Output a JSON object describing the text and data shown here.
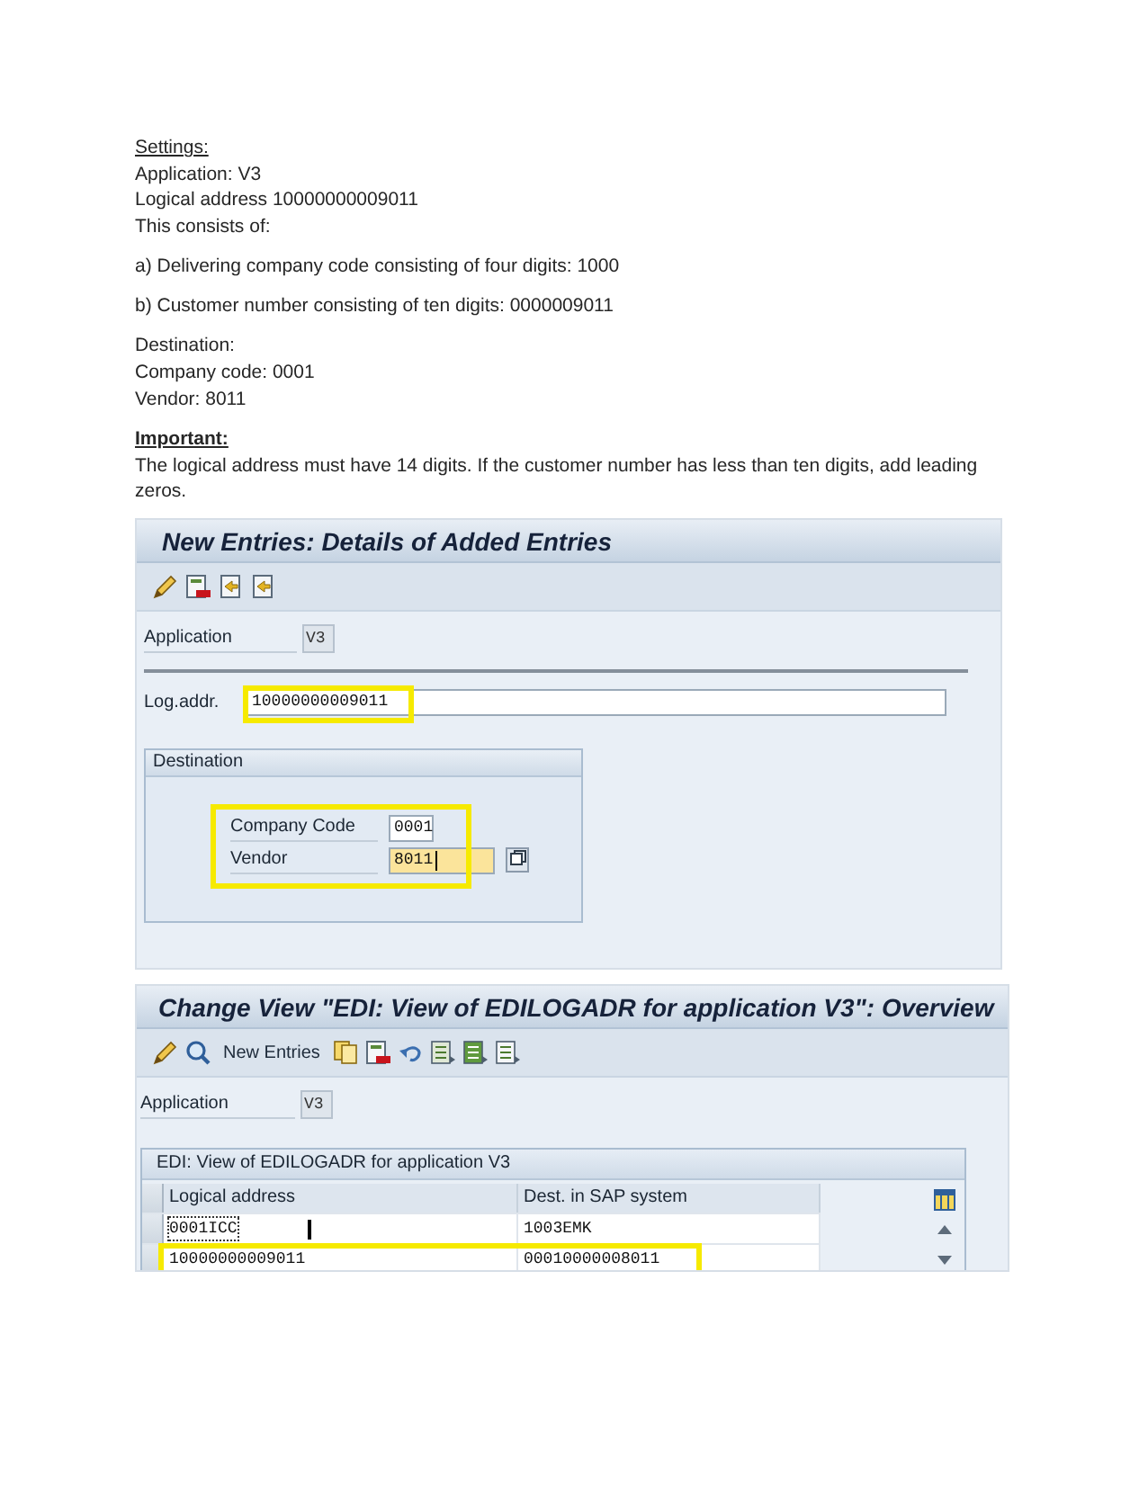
{
  "notes": {
    "settings_heading": "Settings:",
    "settings_lines": [
      "Application: V3",
      "Logical address 10000000009011",
      "This consists of:"
    ],
    "parts": [
      "a) Delivering company code consisting of four digits: 1000",
      "b) Customer number consisting of ten digits: 0000009011"
    ],
    "destination_lines": [
      "Destination:",
      "Company code: 0001",
      "Vendor: 8011"
    ],
    "important_heading": "Important:",
    "important_text": "The logical address must have 14 digits. If the customer number has less than ten digits, add leading zeros."
  },
  "details_screen": {
    "title": "New Entries: Details of Added Entries",
    "application": {
      "label": "Application",
      "value": "V3"
    },
    "log_addr": {
      "label": "Log.addr.",
      "value": "10000000009011",
      "highlighted": true
    },
    "destination": {
      "title": "Destination",
      "highlighted": true,
      "fields": [
        {
          "label": "Company Code",
          "value": "0001",
          "focused": false
        },
        {
          "label": "Vendor",
          "value": "8011",
          "focused": true
        }
      ]
    }
  },
  "overview_screen": {
    "title": "Change View \"EDI: View of EDILOGADR for application V3\": Overview",
    "toolbar_button": "New Entries",
    "application": {
      "label": "Application",
      "value": "V3"
    },
    "table": {
      "title": "EDI: View of EDILOGADR for application V3",
      "columns": [
        "Logical address",
        "Dest. in SAP system"
      ],
      "rows": [
        {
          "cells": [
            "0001ICC",
            "1003EMK"
          ],
          "focused": true,
          "highlighted": false
        },
        {
          "cells": [
            "10000000009011",
            "00010000008011"
          ],
          "focused": false,
          "highlighted": true
        }
      ]
    }
  }
}
